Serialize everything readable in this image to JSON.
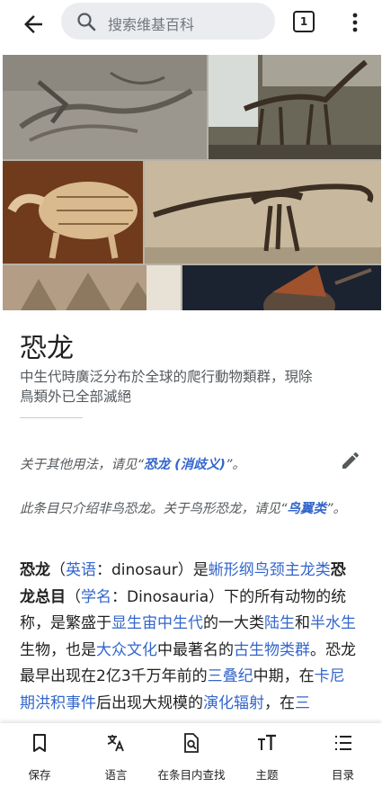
{
  "header": {
    "search_placeholder": "搜索维基百科",
    "tab_count": "1"
  },
  "article": {
    "title": "恐龙",
    "description": "中生代時廣泛分布於全球的爬行動物類群，現除鳥類外已全部滅絕",
    "hatnotes": [
      {
        "prefix": "关于其他用法，请见“",
        "link": "恐龙 (消歧义)",
        "suffix": "”。"
      },
      {
        "prefix": "此条目只介绍非鸟恐龙。关于鸟形恐龙，请见“",
        "link": "鸟翼类",
        "suffix": "”。"
      }
    ],
    "paragraph": [
      {
        "text": "恐龙",
        "style": "bold"
      },
      {
        "text": "（",
        "style": "plain"
      },
      {
        "text": "英语",
        "style": "link"
      },
      {
        "text": "：dinosaur）是",
        "style": "plain"
      },
      {
        "text": "蜥形纲鸟颈主龙类",
        "style": "link"
      },
      {
        "text": "恐龙总目",
        "style": "bold"
      },
      {
        "text": "（",
        "style": "plain"
      },
      {
        "text": "学名",
        "style": "link"
      },
      {
        "text": "：Dinosauria）下的所有动物的统称，是繁盛于",
        "style": "plain"
      },
      {
        "text": "显生宙中生代",
        "style": "link"
      },
      {
        "text": "的一大类",
        "style": "plain"
      },
      {
        "text": "陆生",
        "style": "link"
      },
      {
        "text": "和",
        "style": "plain"
      },
      {
        "text": "半水生",
        "style": "link"
      },
      {
        "text": "生物，也是",
        "style": "plain"
      },
      {
        "text": "大众文化",
        "style": "link"
      },
      {
        "text": "中最著名的",
        "style": "plain"
      },
      {
        "text": "古生物类群",
        "style": "link"
      },
      {
        "text": "。恐龙最早出现在2亿3千万年前的",
        "style": "plain"
      },
      {
        "text": "三叠纪",
        "style": "link"
      },
      {
        "text": "中期，在",
        "style": "plain"
      },
      {
        "text": "卡尼期洪积事件",
        "style": "link"
      },
      {
        "text": "后出现大规模的",
        "style": "plain"
      },
      {
        "text": "演化辐射",
        "style": "link"
      },
      {
        "text": "，在",
        "style": "plain"
      },
      {
        "text": "三",
        "style": "link"
      }
    ]
  },
  "bottom_nav": [
    {
      "label": "保存",
      "icon": "bookmark-icon"
    },
    {
      "label": "语言",
      "icon": "translate-icon"
    },
    {
      "label": "在条目内查找",
      "icon": "find-in-page-icon"
    },
    {
      "label": "主题",
      "icon": "text-format-icon"
    },
    {
      "label": "目录",
      "icon": "contents-list-icon"
    }
  ],
  "colors": {
    "link": "#3366cc",
    "text": "#202122",
    "muted": "#54595d",
    "search_bg": "#eaecf0"
  }
}
